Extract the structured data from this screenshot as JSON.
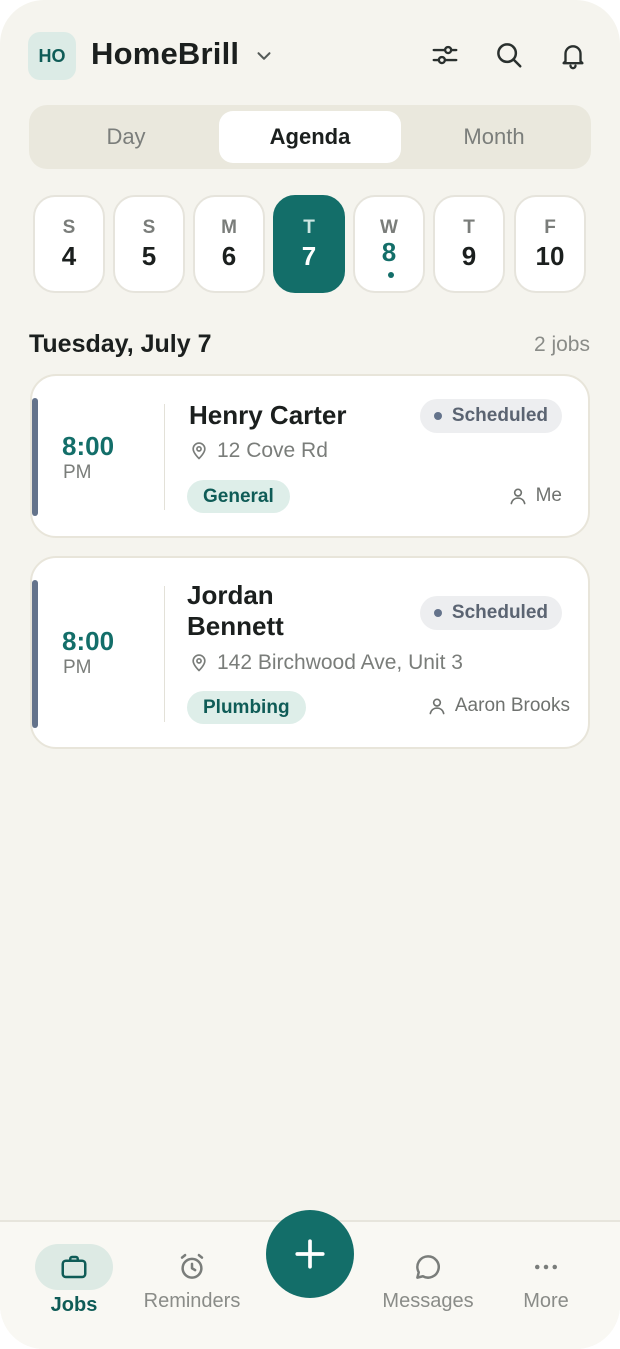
{
  "app": {
    "org_badge": "HO",
    "org_name": "HomeBrill"
  },
  "header_icons": [
    "filter-icon",
    "search-icon",
    "bell-icon"
  ],
  "view_tabs": [
    {
      "label": "Day",
      "active": false
    },
    {
      "label": "Agenda",
      "active": true
    },
    {
      "label": "Month",
      "active": false
    }
  ],
  "date_strip": [
    {
      "dow": "S",
      "day": "4"
    },
    {
      "dow": "S",
      "day": "5"
    },
    {
      "dow": "M",
      "day": "6"
    },
    {
      "dow": "T",
      "day": "7",
      "selected": true
    },
    {
      "dow": "W",
      "day": "8",
      "has_events": true
    },
    {
      "dow": "T",
      "day": "9"
    },
    {
      "dow": "F",
      "day": "10"
    }
  ],
  "section": {
    "title": "Tuesday, July 7",
    "count": "2 jobs"
  },
  "jobs": [
    {
      "time": "8:00",
      "ampm": "PM",
      "name_lines": [
        "Henry Carter"
      ],
      "status": "Scheduled",
      "address": "12 Cove Rd",
      "tag": "General",
      "assignee": "Me"
    },
    {
      "time": "8:00",
      "ampm": "PM",
      "name_lines": [
        "Jordan",
        "Bennett"
      ],
      "status": "Scheduled",
      "address": "142 Birchwood Ave, Unit 3",
      "tag": "Plumbing",
      "assignee": "Aaron Brooks"
    }
  ],
  "bottom_nav": [
    {
      "label": "Jobs",
      "icon": "briefcase-icon",
      "active": true
    },
    {
      "label": "Reminders",
      "icon": "alarm-clock-icon",
      "active": false
    },
    {
      "label": "Messages",
      "icon": "chat-bubble-icon",
      "active": false
    },
    {
      "label": "More",
      "icon": "more-dots-icon",
      "active": false
    }
  ],
  "colors": {
    "accent": "#136e69",
    "background": "#f5f4ee",
    "status_gray": "#64738b",
    "tag_bg": "#deeee9"
  }
}
